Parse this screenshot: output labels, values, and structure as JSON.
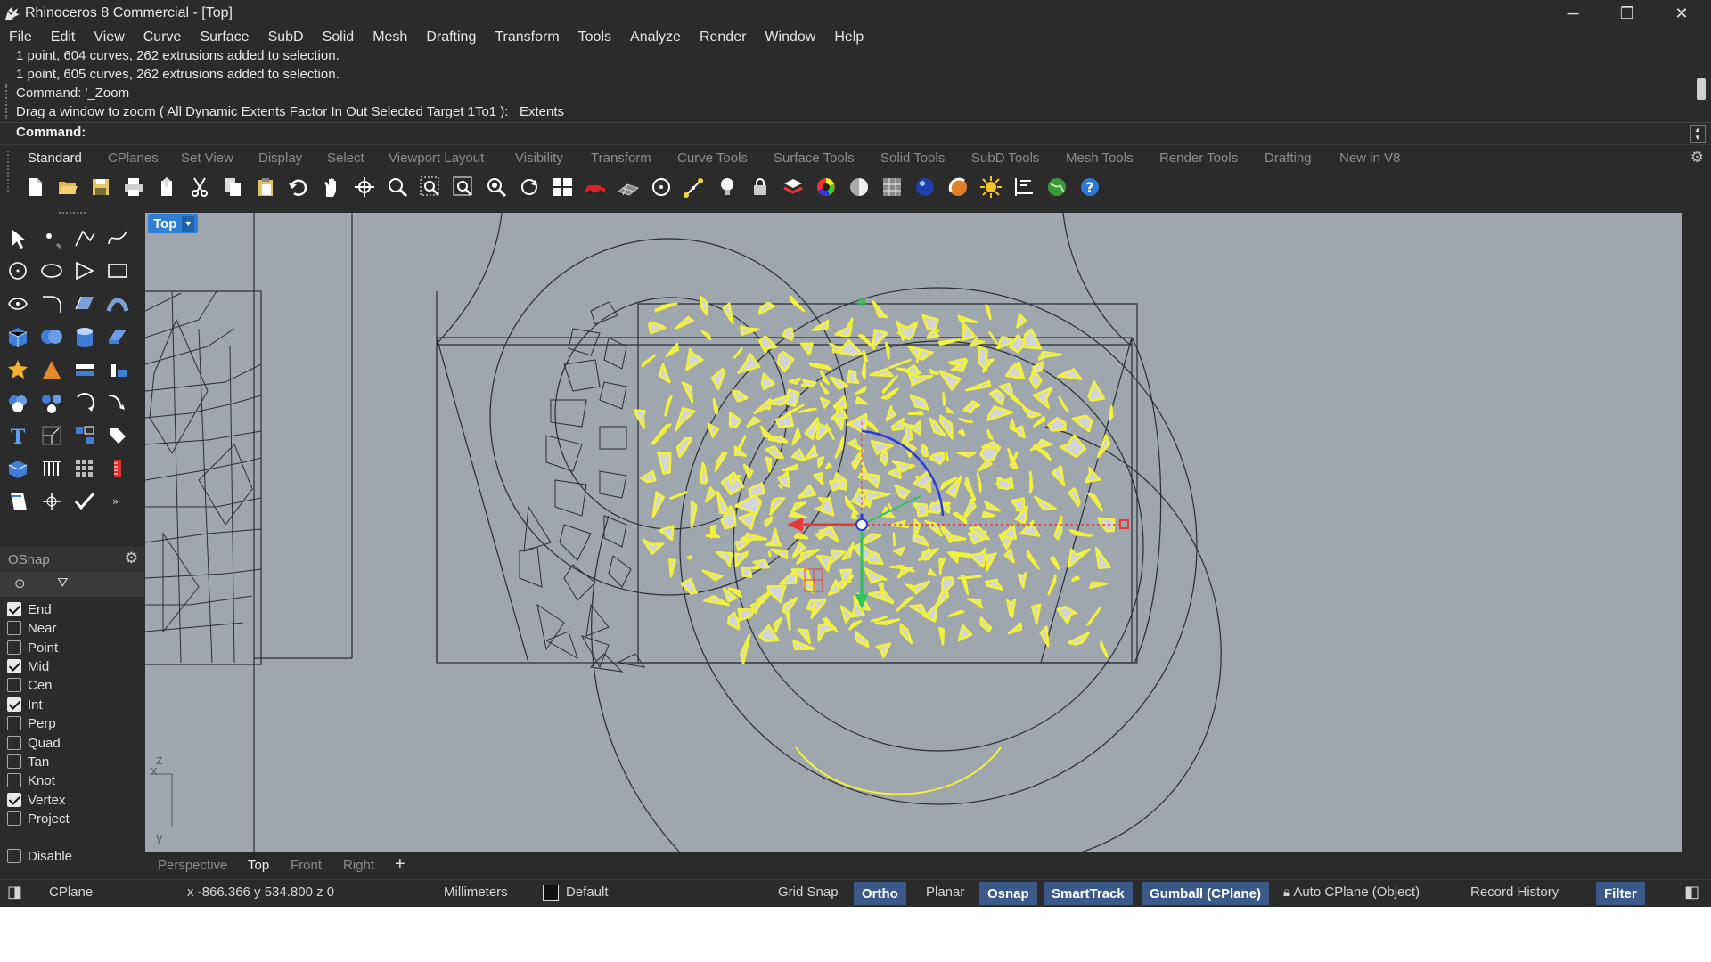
{
  "window": {
    "title": "Rhinoceros 8 Commercial - [Top]",
    "controls": [
      "─",
      "❐",
      "✕"
    ]
  },
  "menu": [
    "File",
    "Edit",
    "View",
    "Curve",
    "Surface",
    "SubD",
    "Solid",
    "Mesh",
    "Drafting",
    "Transform",
    "Tools",
    "Analyze",
    "Render",
    "Window",
    "Help"
  ],
  "command_history": [
    "1 point, 604 curves, 262 extrusions added to selection.",
    "1 point, 605 curves, 262 extrusions added to selection.",
    "Command: '_Zoom",
    "Drag a window to zoom ( All  Dynamic  Extents  Factor  In  Out  Selected  Target  1To1 ): _Extents"
  ],
  "command_prompt": "Command:",
  "toolbar_tabs": [
    "Standard",
    "CPlanes",
    "Set View",
    "Display",
    "Select",
    "Viewport Layout",
    "Visibility",
    "Transform",
    "Curve Tools",
    "Surface Tools",
    "Solid Tools",
    "SubD Tools",
    "Mesh Tools",
    "Render Tools",
    "Drafting",
    "New in V8"
  ],
  "toolbar_active_tab": "Standard",
  "standard_icons": [
    "new-icon",
    "open-icon",
    "save-icon",
    "print-icon",
    "import-icon",
    "cut-icon",
    "copy-icon",
    "paste-icon",
    "undo-icon",
    "pan-hand-icon",
    "rotate-view-icon",
    "zoom-icon",
    "zoom-window-icon",
    "zoom-extents-icon",
    "zoom-selected-icon",
    "rotate-camera-icon",
    "four-viewports-icon",
    "car-icon",
    "grid-plane-icon",
    "select-circle-icon",
    "osnap-points-icon",
    "light-bulb-icon",
    "lock-icon",
    "layer-icon",
    "color-wheel-icon",
    "shaded-sphere-icon",
    "render-mesh-icon",
    "render-sphere-icon",
    "materials-icon",
    "sun-icon",
    "dimension-icon",
    "globe-icon",
    "help-icon"
  ],
  "osnap": {
    "title": "OSnap",
    "items": [
      {
        "label": "End",
        "checked": true
      },
      {
        "label": "Near",
        "checked": false
      },
      {
        "label": "Point",
        "checked": false
      },
      {
        "label": "Mid",
        "checked": true
      },
      {
        "label": "Cen",
        "checked": false
      },
      {
        "label": "Int",
        "checked": true
      },
      {
        "label": "Perp",
        "checked": false
      },
      {
        "label": "Quad",
        "checked": false
      },
      {
        "label": "Tan",
        "checked": false
      },
      {
        "label": "Knot",
        "checked": false
      },
      {
        "label": "Vertex",
        "checked": true
      },
      {
        "label": "Project",
        "checked": false
      }
    ],
    "disable": {
      "label": "Disable",
      "checked": false
    }
  },
  "viewport": {
    "name": "Top",
    "axis_x": "x",
    "axis_y": "y",
    "axis_z": "z",
    "background": "#9fa6ae",
    "selection_color": "#f2f23a"
  },
  "viewport_tabs": [
    "Perspective",
    "Top",
    "Front",
    "Right",
    "+"
  ],
  "viewport_active_tab": "Top",
  "status": {
    "cplane": "CPlane",
    "coords": "x -866.366  y 534.800  z 0",
    "units": "Millimeters",
    "layer": "Default",
    "toggles": [
      {
        "label": "Grid Snap",
        "on": false
      },
      {
        "label": "Ortho",
        "on": true
      },
      {
        "label": "Planar",
        "on": false
      },
      {
        "label": "Osnap",
        "on": true
      },
      {
        "label": "SmartTrack",
        "on": true
      },
      {
        "label": "Gumball (CPlane)",
        "on": true
      },
      {
        "label": "Auto CPlane (Object)",
        "on": false
      },
      {
        "label": "Record History",
        "on": false
      },
      {
        "label": "Filter",
        "on": true
      }
    ]
  }
}
